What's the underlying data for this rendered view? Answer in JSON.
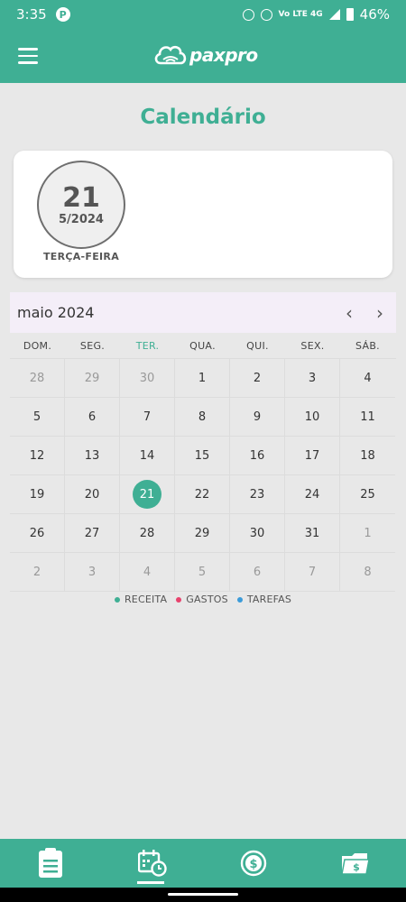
{
  "status_bar": {
    "time": "3:35",
    "badge": "P",
    "network": "Vo LTE 4G",
    "battery": "46%"
  },
  "app_bar": {
    "logo_text": "paxpro"
  },
  "page": {
    "title": "Calendário"
  },
  "selected_date": {
    "day": "21",
    "month_year": "5/2024",
    "weekday": "TERÇA-FEIRA"
  },
  "calendar": {
    "month_label": "maio 2024",
    "prev_icon": "chevron-left-icon",
    "next_icon": "chevron-right-icon",
    "weekdays": [
      "DOM.",
      "SEG.",
      "TER.",
      "QUA.",
      "QUI.",
      "SEX.",
      "SÁB."
    ],
    "active_weekday_index": 2,
    "days": [
      {
        "label": "28",
        "muted": true
      },
      {
        "label": "29",
        "muted": true
      },
      {
        "label": "30",
        "muted": true
      },
      {
        "label": "1"
      },
      {
        "label": "2"
      },
      {
        "label": "3"
      },
      {
        "label": "4"
      },
      {
        "label": "5"
      },
      {
        "label": "6"
      },
      {
        "label": "7"
      },
      {
        "label": "8"
      },
      {
        "label": "9"
      },
      {
        "label": "10"
      },
      {
        "label": "11"
      },
      {
        "label": "12"
      },
      {
        "label": "13"
      },
      {
        "label": "14"
      },
      {
        "label": "15"
      },
      {
        "label": "16"
      },
      {
        "label": "17"
      },
      {
        "label": "18"
      },
      {
        "label": "19"
      },
      {
        "label": "20"
      },
      {
        "label": "21",
        "today": true
      },
      {
        "label": "22"
      },
      {
        "label": "23"
      },
      {
        "label": "24"
      },
      {
        "label": "25"
      },
      {
        "label": "26"
      },
      {
        "label": "27"
      },
      {
        "label": "28"
      },
      {
        "label": "29"
      },
      {
        "label": "30"
      },
      {
        "label": "31"
      },
      {
        "label": "1",
        "muted": true
      },
      {
        "label": "2",
        "muted": true
      },
      {
        "label": "3",
        "muted": true
      },
      {
        "label": "4",
        "muted": true
      },
      {
        "label": "5",
        "muted": true
      },
      {
        "label": "6",
        "muted": true
      },
      {
        "label": "7",
        "muted": true
      },
      {
        "label": "8",
        "muted": true
      }
    ]
  },
  "legend": [
    {
      "label": "RECEITA",
      "color": "#3faf94"
    },
    {
      "label": "GASTOS",
      "color": "#e8426d"
    },
    {
      "label": "TAREFAS",
      "color": "#3b9bd9"
    }
  ],
  "bottom_nav": [
    {
      "icon": "document-icon"
    },
    {
      "icon": "calendar-clock-icon",
      "active": true
    },
    {
      "icon": "dollar-coin-icon"
    },
    {
      "icon": "wallet-icon"
    }
  ],
  "colors": {
    "primary": "#3faf94",
    "background": "#e8e8e8"
  }
}
